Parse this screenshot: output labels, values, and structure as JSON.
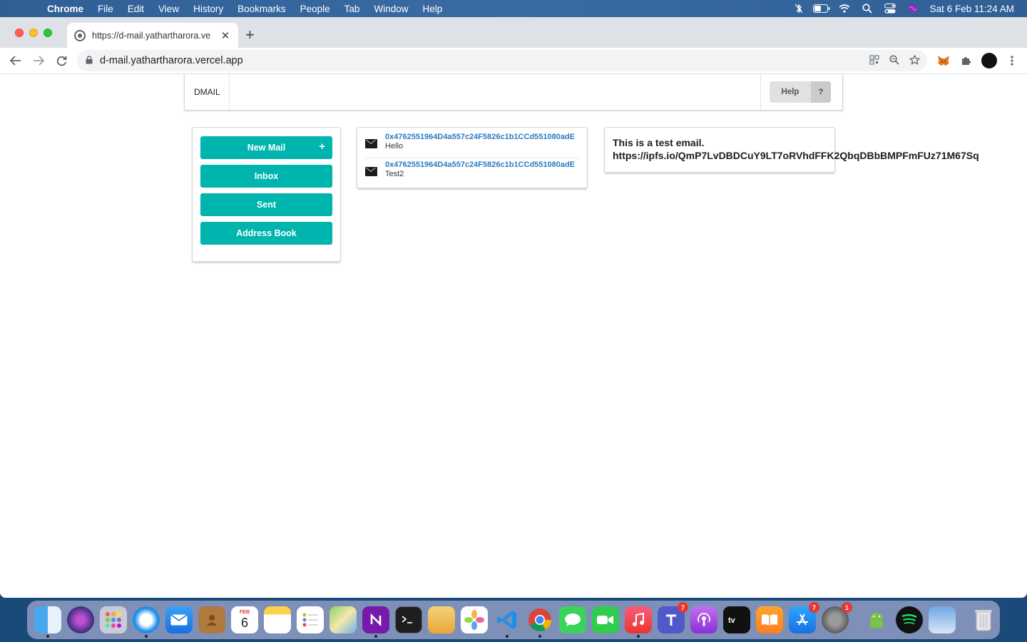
{
  "menubar": {
    "app": "Chrome",
    "items": [
      "File",
      "Edit",
      "View",
      "History",
      "Bookmarks",
      "People",
      "Tab",
      "Window",
      "Help"
    ],
    "clock": "Sat 6 Feb  11:24 AM",
    "icons": [
      "bluetooth-off-icon",
      "battery-icon",
      "wifi-icon",
      "spotlight-icon",
      "control-center-icon",
      "siri-icon"
    ]
  },
  "browser": {
    "tab_title": "https://d-mail.yathartharora.ve",
    "tab_close": "✕",
    "new_tab": "+",
    "url": "d-mail.yathartharora.vercel.app"
  },
  "app": {
    "brand": "DMAIL",
    "help_label": "Help",
    "help_icon": "?",
    "sidebar": {
      "new_mail": "New Mail",
      "new_mail_icon": "+",
      "inbox": "Inbox",
      "sent": "Sent",
      "address_book": "Address Book"
    },
    "mails": [
      {
        "from": "0x4762551964D4a557c24F5826c1b1CCd551080adE",
        "subject": "Hello"
      },
      {
        "from": "0x4762551964D4a557c24F5826c1b1CCd551080adE",
        "subject": "Test2"
      }
    ],
    "viewer": {
      "body_line1": "This is a test email.",
      "body_line2": "https://ipfs.io/QmP7LvDBDCuY9LT7oRVhdFFK2QbqDBbBMPFmFUz71M67Sq"
    }
  },
  "dock": {
    "calendar_month": "FEB",
    "calendar_day": "6",
    "teams_badge": "7",
    "settings_badge": "1"
  },
  "colors": {
    "teal": "#00b5ad",
    "link_blue": "#2b7bbf"
  }
}
